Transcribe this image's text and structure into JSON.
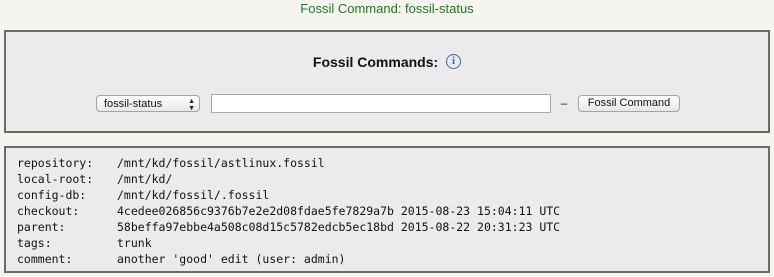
{
  "page": {
    "title": "Fossil Command: fossil-status"
  },
  "command_panel": {
    "heading": "Fossil Commands:",
    "info_glyph": "i",
    "info_icon": "info-circle-icon",
    "select": {
      "selected": "fossil-status",
      "arrows": "▲▼"
    },
    "args_input": {
      "value": "",
      "placeholder": ""
    },
    "separator": "–",
    "run_button": "Fossil Command"
  },
  "output": {
    "rows": [
      {
        "key": "repository:",
        "value": "/mnt/kd/fossil/astlinux.fossil"
      },
      {
        "key": "local-root:",
        "value": "/mnt/kd/"
      },
      {
        "key": "config-db:",
        "value": "/mnt/kd/fossil/.fossil"
      },
      {
        "key": "checkout:",
        "value": "4cedee026856c9376b7e2e2d08fdae5fe7829a7b 2015-08-23 15:04:11 UTC"
      },
      {
        "key": "parent:",
        "value": "58beffa97ebbe4a508c08d15c5782edcb5ec18bd 2015-08-22 20:31:23 UTC"
      },
      {
        "key": "tags:",
        "value": "trunk"
      },
      {
        "key": "comment:",
        "value": "another 'good' edit (user: admin)"
      }
    ]
  },
  "colors": {
    "title_green": "#1f7a1f",
    "panel_bg": "#ebebeb",
    "panel_border": "#6b6b6b",
    "page_bg": "#f5f4ee",
    "info_blue": "#3b5fd0"
  }
}
